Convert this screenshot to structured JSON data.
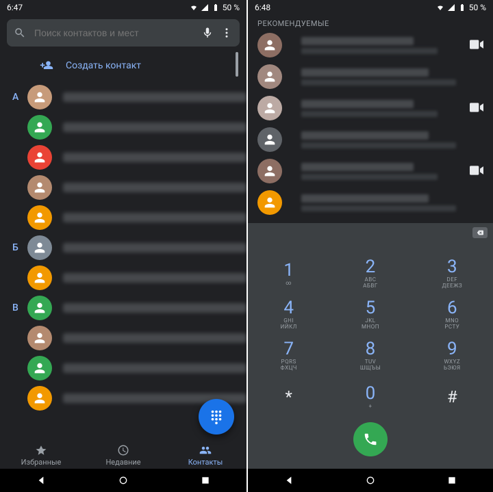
{
  "left": {
    "time": "6:47",
    "battery": "50 %",
    "searchPlaceholder": "Поиск контактов и мест",
    "createLabel": "Создать контакт",
    "letters": [
      "А",
      "",
      "",
      "",
      "",
      "Б",
      "",
      "В",
      "",
      "",
      ""
    ],
    "avColors": [
      "#c79b7a",
      "#34a853",
      "#ea4335",
      "#b48a6f",
      "#f29900",
      "#7e8a96",
      "#f29900",
      "#34a853",
      "#b48a6f",
      "#34a853",
      "#f29900"
    ],
    "nameWidths": [
      "46%",
      "78%",
      "52%",
      "44%",
      "28%",
      "30%",
      "48%",
      "58%",
      "24%",
      "40%",
      "36%"
    ],
    "tabs": {
      "fav": "Избранные",
      "recent": "Недавние",
      "contacts": "Контакты"
    }
  },
  "right": {
    "time": "6:48",
    "battery": "50 %",
    "recommendLabel": "РЕКОМЕНДУЕМЫЕ",
    "recAvColors": [
      "#8d6e63",
      "#a1887f",
      "#bcaaa4",
      "#5f6368",
      "#8d6e63",
      "#f29900"
    ],
    "recHasVideo": [
      true,
      false,
      true,
      false,
      true,
      false
    ],
    "keys": [
      {
        "n": "1",
        "s": "∞"
      },
      {
        "n": "2",
        "s": "ABC\nАБВГ"
      },
      {
        "n": "3",
        "s": "DEF\nДЕЕЖЗ"
      },
      {
        "n": "4",
        "s": "GHI\nИЙКЛ"
      },
      {
        "n": "5",
        "s": "JKL\nМНОП"
      },
      {
        "n": "6",
        "s": "MNO\nРСТУ"
      },
      {
        "n": "7",
        "s": "PQRS\nФХЦЧ"
      },
      {
        "n": "8",
        "s": "TUV\nШЩЪЫ"
      },
      {
        "n": "9",
        "s": "WXYZ\nЬЭЮЯ"
      },
      {
        "n": "*",
        "s": "",
        "sym": true
      },
      {
        "n": "0",
        "s": "+"
      },
      {
        "n": "#",
        "s": "",
        "sym": true
      }
    ]
  }
}
